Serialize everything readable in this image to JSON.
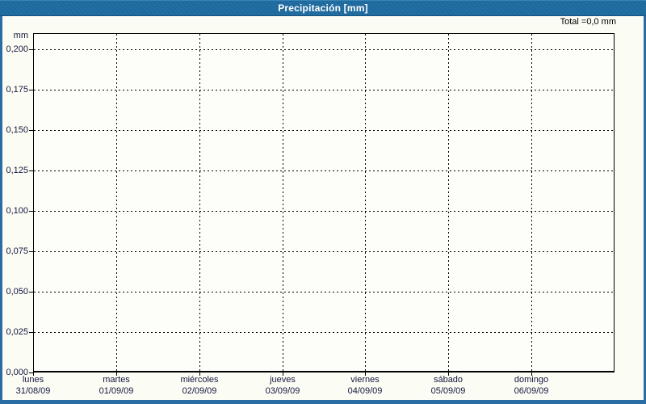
{
  "titlebar": {
    "title": "Precipitación [mm]",
    "background_color": "#1e6a9e",
    "text_color": "#ffffff"
  },
  "window": {
    "background_color": "#fbfdf5",
    "border_color": "#2a6da5"
  },
  "chart_data": {
    "type": "bar",
    "title": "Precipitación [mm]",
    "total_label": "Total =0,0 mm",
    "unit_label": "mm",
    "ylabel": "mm",
    "xlabel": "",
    "ylim": [
      0,
      0.21
    ],
    "grid": "dashed horizontal and vertical, black on off-white",
    "legend_position": "none",
    "y_ticks": [
      {
        "label": "0,200",
        "value": 0.2
      },
      {
        "label": "0,175",
        "value": 0.175
      },
      {
        "label": "0,150",
        "value": 0.15
      },
      {
        "label": "0,125",
        "value": 0.125
      },
      {
        "label": "0,100",
        "value": 0.1
      },
      {
        "label": "0,075",
        "value": 0.075
      },
      {
        "label": "0,050",
        "value": 0.05
      },
      {
        "label": "0,025",
        "value": 0.025
      },
      {
        "label": "0,000",
        "value": 0.0
      }
    ],
    "categories": [
      {
        "day": "lunes",
        "date": "31/08/09"
      },
      {
        "day": "martes",
        "date": "01/09/09"
      },
      {
        "day": "miércoles",
        "date": "02/09/09"
      },
      {
        "day": "jueves",
        "date": "03/09/09"
      },
      {
        "day": "viernes",
        "date": "04/09/09"
      },
      {
        "day": "sábado",
        "date": "05/09/09"
      },
      {
        "day": "domingo",
        "date": "06/09/09"
      }
    ],
    "series": [
      {
        "name": "Precipitación",
        "values": [
          0,
          0,
          0,
          0,
          0,
          0,
          0
        ]
      }
    ],
    "colors": {
      "grid": "#000000",
      "tick_text": "#14143c",
      "total_text": "#000000"
    }
  }
}
